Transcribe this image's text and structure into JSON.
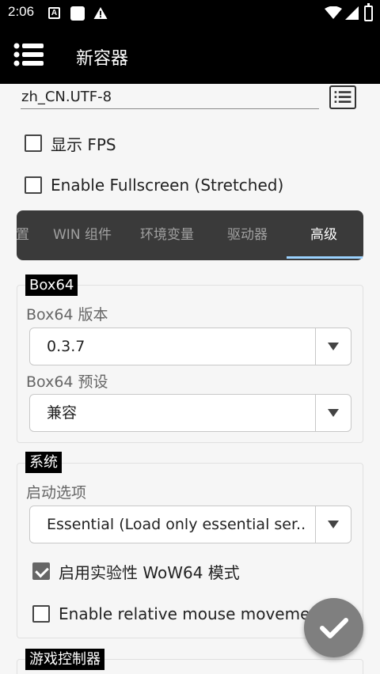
{
  "status_bar": {
    "time": "2:06",
    "notif_a": "A"
  },
  "app_bar": {
    "title": "新容器"
  },
  "locale": {
    "value": "zh_CN.UTF-8"
  },
  "checkboxes": {
    "show_fps": {
      "label": "显示 FPS",
      "checked": false
    },
    "fullscreen": {
      "label": "Enable Fullscreen (Stretched)",
      "checked": false
    }
  },
  "tabs": [
    {
      "label": "置"
    },
    {
      "label": "WIN 组件"
    },
    {
      "label": "环境变量"
    },
    {
      "label": "驱动器"
    },
    {
      "label": "高级",
      "active": true
    }
  ],
  "box64": {
    "tag": "Box64",
    "version_label": "Box64 版本",
    "version_value": "0.3.7",
    "preset_label": "Box64 预设",
    "preset_value": "兼容"
  },
  "system": {
    "tag": "系统",
    "startup_label": "启动选项",
    "startup_value": "Essential (Load only essential ser..",
    "wow64_label": "启用实验性 WoW64 模式",
    "wow64_checked": true,
    "relative_mouse_label": "Enable relative mouse movement",
    "relative_mouse_checked": false
  },
  "game_controller": {
    "tag": "游戏控制器"
  },
  "colors": {
    "tab_indicator": "#9ad2ff",
    "fab": "#7f7f7f",
    "tab_bg": "#3a3a3a"
  }
}
